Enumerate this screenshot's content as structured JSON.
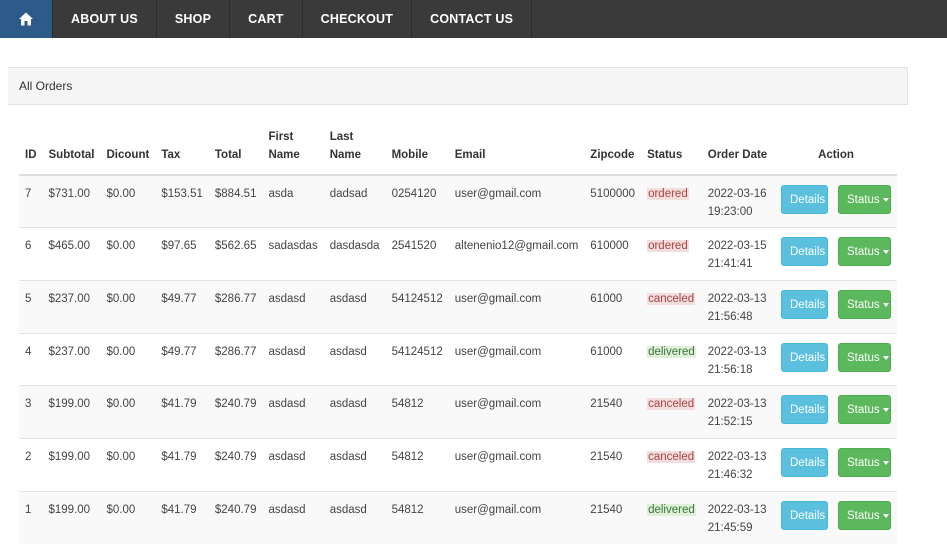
{
  "nav": {
    "home_icon": "home-icon",
    "items": [
      "ABOUT US",
      "SHOP",
      "CART",
      "CHECKOUT",
      "CONTACT US"
    ]
  },
  "panel": {
    "title": "All Orders"
  },
  "table": {
    "headers": {
      "id": "ID",
      "subtotal": "Subtotal",
      "discount": "Dicount",
      "tax": "Tax",
      "total": "Total",
      "first_name": "First Name",
      "last_name": "Last Name",
      "mobile": "Mobile",
      "email": "Email",
      "zipcode": "Zipcode",
      "status": "Status",
      "order_date": "Order Date",
      "action": "Action"
    },
    "rows": [
      {
        "id": "7",
        "subtotal": "$731.00",
        "discount": "$0.00",
        "tax": "$153.51",
        "total": "$884.51",
        "first_name": "asda",
        "last_name": "dadsad",
        "mobile": "0254120",
        "email": "user@gmail.com",
        "zipcode": "5100000",
        "status": "ordered",
        "date": "2022-03-16",
        "time": "19:23:00"
      },
      {
        "id": "6",
        "subtotal": "$465.00",
        "discount": "$0.00",
        "tax": "$97.65",
        "total": "$562.65",
        "first_name": "sadasdas",
        "last_name": "dasdasda",
        "mobile": "2541520",
        "email": "altenenio12@gmail.com",
        "zipcode": "610000",
        "status": "ordered",
        "date": "2022-03-15",
        "time": "21:41:41"
      },
      {
        "id": "5",
        "subtotal": "$237.00",
        "discount": "$0.00",
        "tax": "$49.77",
        "total": "$286.77",
        "first_name": "asdasd",
        "last_name": "asdasd",
        "mobile": "54124512",
        "email": "user@gmail.com",
        "zipcode": "61000",
        "status": "canceled",
        "date": "2022-03-13",
        "time": "21:56:48"
      },
      {
        "id": "4",
        "subtotal": "$237.00",
        "discount": "$0.00",
        "tax": "$49.77",
        "total": "$286.77",
        "first_name": "asdasd",
        "last_name": "asdasd",
        "mobile": "54124512",
        "email": "user@gmail.com",
        "zipcode": "61000",
        "status": "delivered",
        "date": "2022-03-13",
        "time": "21:56:18"
      },
      {
        "id": "3",
        "subtotal": "$199.00",
        "discount": "$0.00",
        "tax": "$41.79",
        "total": "$240.79",
        "first_name": "asdasd",
        "last_name": "asdasd",
        "mobile": "54812",
        "email": "user@gmail.com",
        "zipcode": "21540",
        "status": "canceled",
        "date": "2022-03-13",
        "time": "21:52:15"
      },
      {
        "id": "2",
        "subtotal": "$199.00",
        "discount": "$0.00",
        "tax": "$41.79",
        "total": "$240.79",
        "first_name": "asdasd",
        "last_name": "asdasd",
        "mobile": "54812",
        "email": "user@gmail.com",
        "zipcode": "21540",
        "status": "canceled",
        "date": "2022-03-13",
        "time": "21:46:32"
      },
      {
        "id": "1",
        "subtotal": "$199.00",
        "discount": "$0.00",
        "tax": "$41.79",
        "total": "$240.79",
        "first_name": "asdasd",
        "last_name": "asdasd",
        "mobile": "54812",
        "email": "user@gmail.com",
        "zipcode": "21540",
        "status": "delivered",
        "date": "2022-03-13",
        "time": "21:45:59"
      }
    ],
    "details_label": "Details",
    "status_label": "Status"
  },
  "colors": {
    "navbar": "#3a3a3a",
    "home_active": "#2c5b8a",
    "details_button": "#5bc0de",
    "status_button": "#5cb85c"
  }
}
